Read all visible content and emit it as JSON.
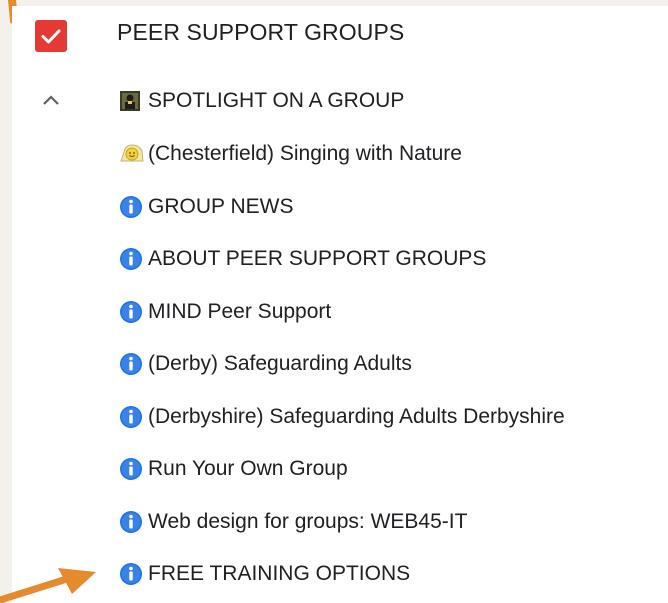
{
  "header": {
    "title": "PEER SUPPORT GROUPS",
    "checked": true,
    "expanded": true
  },
  "colors": {
    "checkbox": "#e53935",
    "info_icon": "#1a73e8",
    "annotation_arrow": "#e58a2d"
  },
  "items": [
    {
      "icon": "group-photo-icon",
      "label": "SPOTLIGHT ON A GROUP"
    },
    {
      "icon": "smiley-sun-icon",
      "label": "(Chesterfield) Singing with Nature"
    },
    {
      "icon": "info-icon",
      "label": "GROUP NEWS"
    },
    {
      "icon": "info-icon",
      "label": "ABOUT PEER SUPPORT GROUPS"
    },
    {
      "icon": "info-icon",
      "label": "MIND Peer Support"
    },
    {
      "icon": "info-icon",
      "label": "(Derby) Safeguarding Adults"
    },
    {
      "icon": "info-icon",
      "label": "(Derbyshire) Safeguarding Adults Derbyshire"
    },
    {
      "icon": "info-icon",
      "label": "Run Your Own Group"
    },
    {
      "icon": "info-icon",
      "label": "Web design for groups: WEB45-IT"
    },
    {
      "icon": "info-icon",
      "label": "FREE TRAINING OPTIONS"
    }
  ]
}
